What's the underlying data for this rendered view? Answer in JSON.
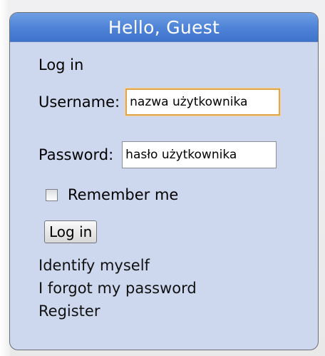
{
  "panel": {
    "title": "Hello, Guest"
  },
  "login_form": {
    "heading": "Log in",
    "username": {
      "label": "Username:",
      "value": "nazwa użytkownika"
    },
    "password": {
      "label": "Password:",
      "value": "hasło użytkownika"
    },
    "remember_me": {
      "label": "Remember me",
      "checked": false
    },
    "submit_label": "Log in"
  },
  "links": {
    "identify": "Identify myself",
    "forgot_password": "I forgot my password",
    "register": "Register"
  },
  "colors": {
    "header_blue": "#4d82d6",
    "panel_bg": "#cdd8ef",
    "focus_border": "#e0a64a"
  }
}
